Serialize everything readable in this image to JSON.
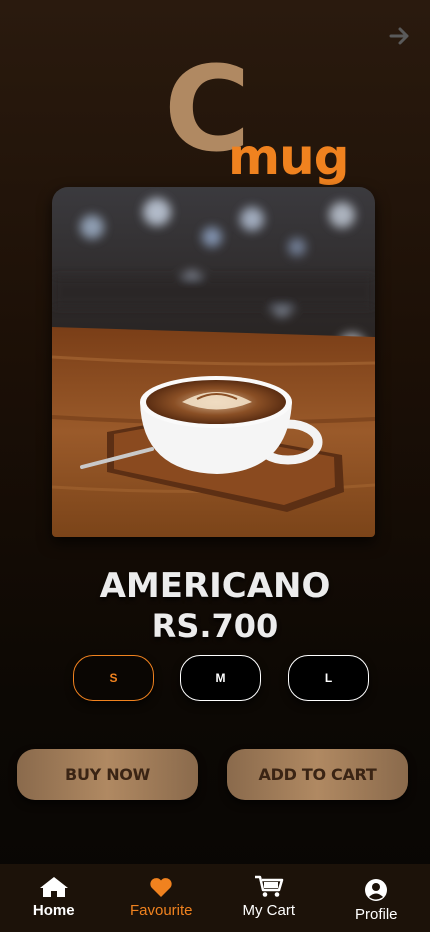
{
  "header": {
    "forward_icon": "arrow-right-icon"
  },
  "logo": {
    "letter": "C",
    "word": "mug",
    "colors": {
      "letter": "#b08962",
      "word": "#f0821f"
    }
  },
  "product": {
    "image": "latte-art-coffee-cup-photo",
    "name": "AMERICANO",
    "price": "RS.700"
  },
  "sizes": [
    {
      "label": "S",
      "selected": true
    },
    {
      "label": "M",
      "selected": false
    },
    {
      "label": "L",
      "selected": false
    }
  ],
  "actions": {
    "buy_now": "BUY NOW",
    "add_to_cart": "ADD TO CART"
  },
  "nav": [
    {
      "label": "Home",
      "icon": "home-icon",
      "active": false
    },
    {
      "label": "Favourite",
      "icon": "heart-icon",
      "active": true
    },
    {
      "label": "My Cart",
      "icon": "cart-icon",
      "active": false
    },
    {
      "label": "Profile",
      "icon": "profile-icon",
      "active": false
    }
  ],
  "colors": {
    "accent": "#f0821f",
    "tan": "#b08962",
    "nav_background": "#1c1209"
  }
}
